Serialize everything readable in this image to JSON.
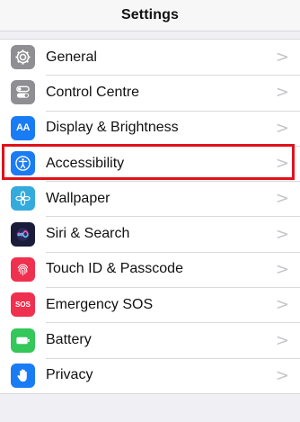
{
  "nav": {
    "title": "Settings"
  },
  "rows": [
    {
      "label": "General",
      "icon": "gear-icon",
      "color": "#8e8e93"
    },
    {
      "label": "Control Centre",
      "icon": "toggles-icon",
      "color": "#8e8e93"
    },
    {
      "label": "Display & Brightness",
      "icon": "aa-icon",
      "color": "#1a7cf5",
      "icon_text": "AA"
    },
    {
      "label": "Accessibility",
      "icon": "accessibility-icon",
      "color": "#1a7cf5"
    },
    {
      "label": "Wallpaper",
      "icon": "flower-icon",
      "color": "#35aadc"
    },
    {
      "label": "Siri & Search",
      "icon": "siri-icon",
      "color": "#1b1b3a"
    },
    {
      "label": "Touch ID & Passcode",
      "icon": "fingerprint-icon",
      "color": "#f0304f"
    },
    {
      "label": "Emergency SOS",
      "icon": "sos-icon",
      "color": "#f0304f",
      "icon_text": "SOS"
    },
    {
      "label": "Battery",
      "icon": "battery-icon",
      "color": "#34c759"
    },
    {
      "label": "Privacy",
      "icon": "hand-icon",
      "color": "#1a7cf5"
    }
  ],
  "chevron": ">"
}
